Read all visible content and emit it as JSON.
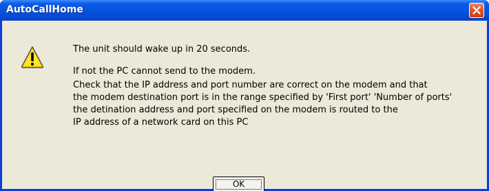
{
  "window": {
    "title": "AutoCallHome",
    "close_icon": "close-icon"
  },
  "dialog": {
    "icon": "warning-icon",
    "message_lines": [
      "The unit should wake up in 20 seconds.",
      "If not the PC cannot send to the modem.",
      "Check that the IP address and port number are correct on the modem and that",
      "the modem destination port is in the range specified by 'First port' 'Number of ports'",
      "the detination address and port specified on the modem is routed to the",
      "IP address of a network card on this PC"
    ],
    "ok_label": "OK"
  },
  "colors": {
    "titlebar": "#0553e0",
    "client_background": "#ece9d8",
    "close_button": "#e0542c",
    "warning_fill": "#ffd800"
  }
}
